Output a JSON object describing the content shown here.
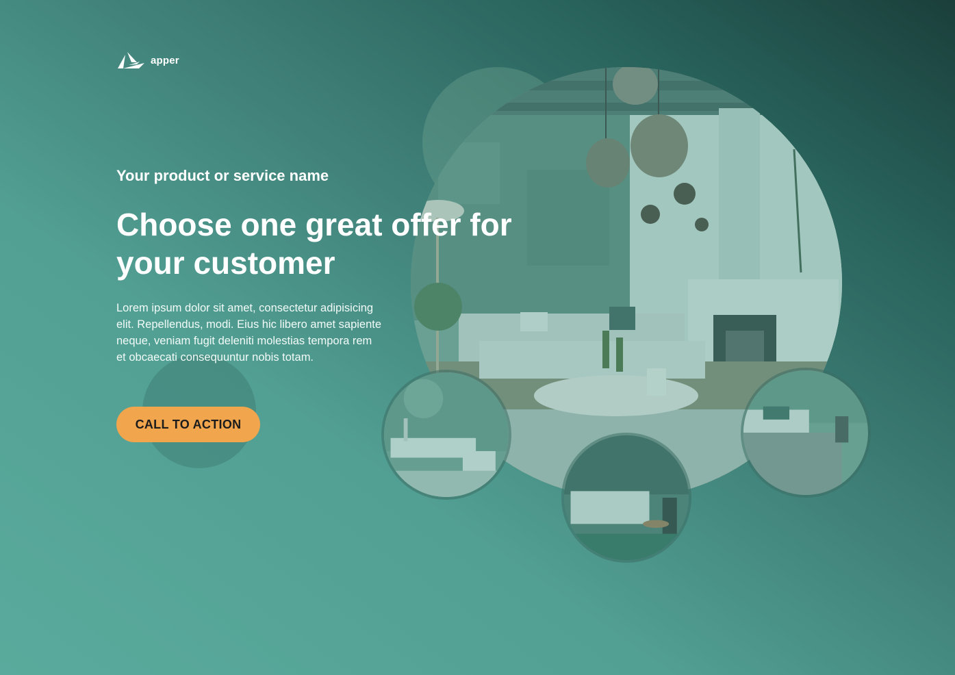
{
  "brand": {
    "name": "apper",
    "logo_icon": "apper-logo-icon"
  },
  "hero": {
    "eyebrow": "Your product or service name",
    "headline": "Choose one great offer for your customer",
    "body": "Lorem ipsum dolor sit amet, consectetur adipisicing elit. Repellendus, modi. Eius hic libero amet sapiente neque, veniam fugit deleniti molestias tempora rem et obcaecati consequuntur nobis totam.",
    "cta_label": "CALL TO ACTION"
  },
  "colors": {
    "background_light": "#5aab9d",
    "background_dark": "#1b3f3b",
    "cta": "#f1a54d",
    "text": "#ffffff"
  }
}
